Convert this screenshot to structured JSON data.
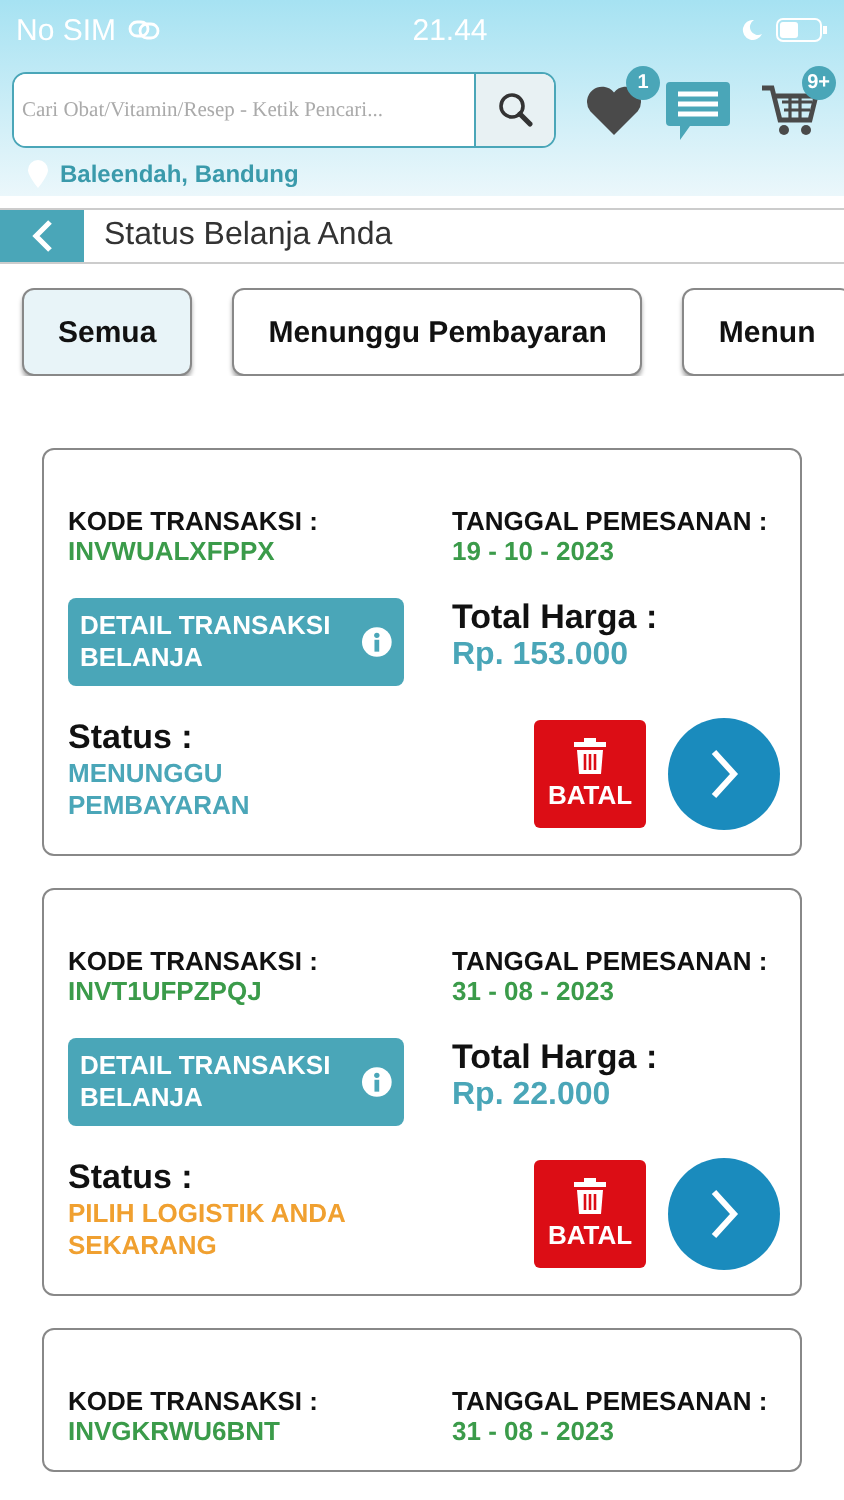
{
  "status_bar": {
    "carrier": "No SIM",
    "time": "21.44"
  },
  "header": {
    "search": {
      "placeholder": "Cari Obat/Vitamin/Resep - Ketik Pencari..."
    },
    "wishlist_badge": "1",
    "cart_badge": "9+",
    "location": "Baleendah, Bandung"
  },
  "title_bar": {
    "title": "Status Belanja Anda"
  },
  "filters": [
    {
      "label": "Semua",
      "selected": true
    },
    {
      "label": "Menunggu Pembayaran",
      "selected": false
    },
    {
      "label": "Menun",
      "selected": false
    }
  ],
  "orders": [
    {
      "code_label": "KODE TRANSAKSI :",
      "code": "INVWUALXFPPX",
      "date_label": "TANGGAL PEMESANAN :",
      "date": "19 - 10 - 2023",
      "detail_button": "DETAIL TRANSAKSI BELANJA",
      "total_label": "Total Harga :",
      "total": "Rp. 153.000",
      "status_label": "Status :",
      "status": "MENUNGGU PEMBAYARAN",
      "color": "#4aa6b8",
      "cancel_button": "BATAL"
    },
    {
      "code_label": "KODE TRANSAKSI :",
      "code": "INVT1UFPZPQJ",
      "date_label": "TANGGAL PEMESANAN :",
      "date": "31 - 08 - 2023",
      "detail_button": "DETAIL TRANSAKSI BELANJA",
      "total_label": "Total Harga :",
      "total": "Rp. 22.000",
      "status_label": "Status :",
      "status": "PILIH LOGISTIK ANDA SEKARANG",
      "color": "#f0a030",
      "cancel_button": "BATAL"
    },
    {
      "code_label": "KODE TRANSAKSI :",
      "code": "INVGKRWU6BNT",
      "date_label": "TANGGAL PEMESANAN :",
      "date": "31 - 08 - 2023"
    }
  ]
}
